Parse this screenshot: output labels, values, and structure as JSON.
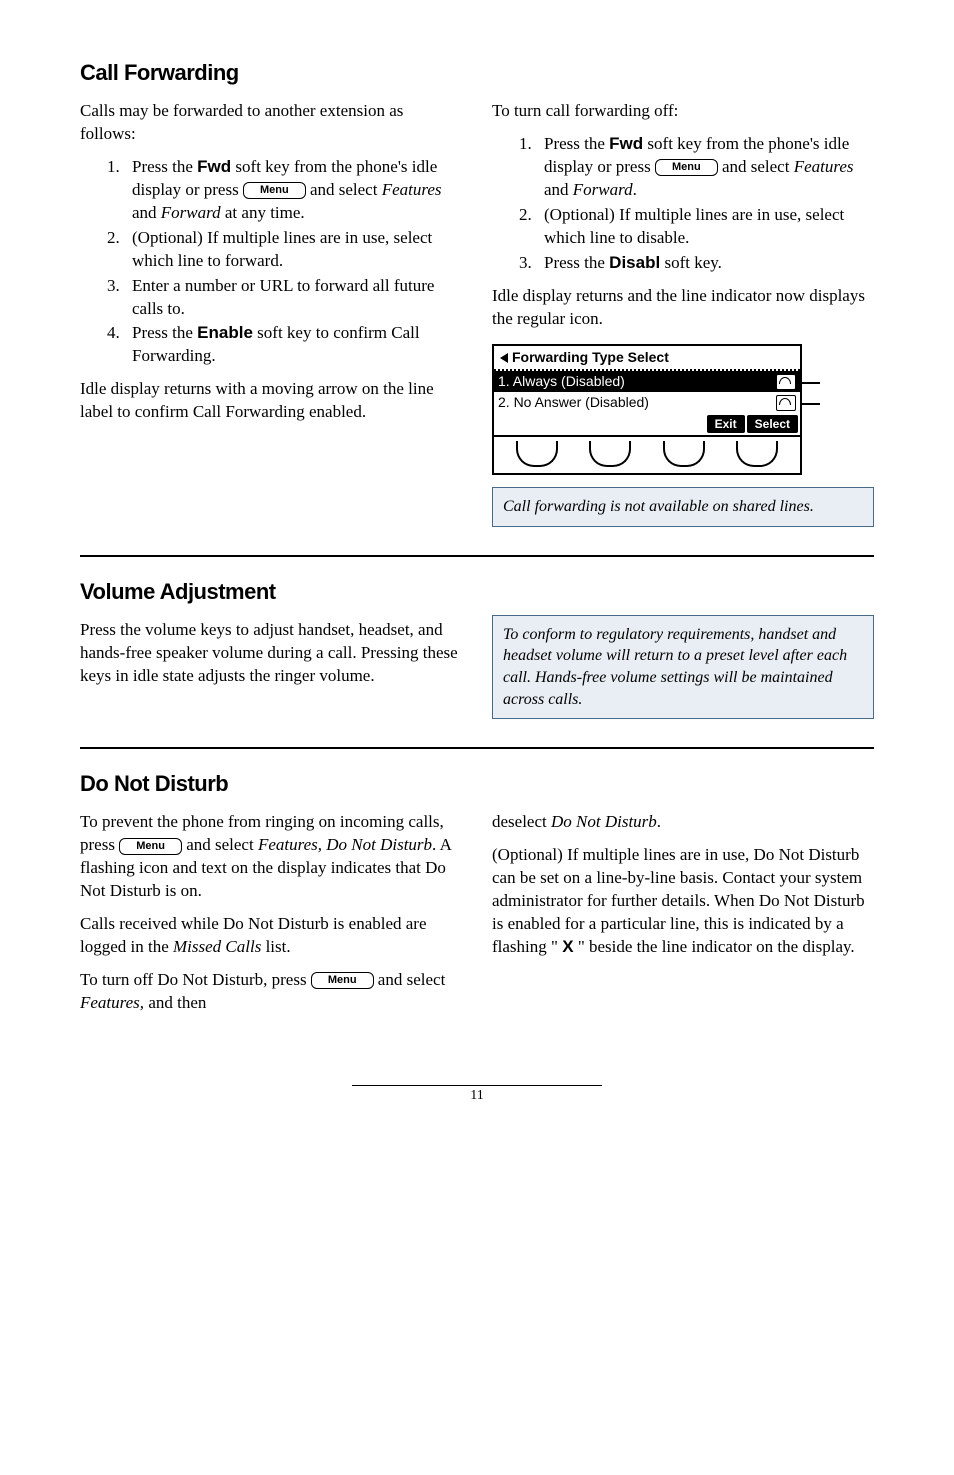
{
  "sections": {
    "call_forwarding": {
      "heading": "Call Forwarding",
      "left": {
        "intro": "Calls may be forwarded to another extension as follows:",
        "steps": {
          "s1_a": "Press the ",
          "s1_key": "Fwd",
          "s1_b": " soft key from the phone's idle display or press ",
          "s1_menu": "Menu",
          "s1_c": " and select ",
          "s1_feat": "Features",
          "s1_d": " and ",
          "s1_fwd": "Forward",
          "s1_e": " at any time.",
          "s2": "(Optional) If multiple lines are in use, select which line to forward.",
          "s3": "Enter a number or URL to forward all future calls to.",
          "s4_a": "Press the ",
          "s4_key": "Enable",
          "s4_b": " soft key to confirm Call Forwarding."
        },
        "outro": "Idle display returns with a moving arrow on the line label to confirm Call Forwarding enabled."
      },
      "right": {
        "intro": "To turn call forwarding off:",
        "steps": {
          "s1_a": "Press the ",
          "s1_key": "Fwd",
          "s1_b": " soft key from the phone's idle display or press ",
          "s1_menu": "Menu",
          "s1_c": " and select ",
          "s1_feat": "Features",
          "s1_d": " and ",
          "s1_fwd": "Forward",
          "s1_e": ".",
          "s2": "(Optional) If multiple lines are in use, select which line to disable.",
          "s3_a": "Press the ",
          "s3_key": "Disabl",
          "s3_b": " soft key."
        },
        "outro": "Idle display returns and the line indicator now displays the regular icon.",
        "screen": {
          "title": "Forwarding Type Select",
          "row1": "1. Always (Disabled)",
          "row2": "2. No Answer (Disabled)",
          "sk1": "Exit",
          "sk2": "Select"
        },
        "note": "Call forwarding is not available on shared lines."
      }
    },
    "volume": {
      "heading": "Volume Adjustment",
      "body": "Press the volume keys to adjust handset, headset, and hands-free speaker volume during a call.  Pressing these keys in idle state adjusts the ringer volume.",
      "note": "To conform to regulatory requirements, handset and headset volume will return to a preset level after each call.  Hands-free volume settings will be maintained across calls."
    },
    "dnd": {
      "heading": "Do Not Disturb",
      "left": {
        "p1_a": "To prevent the phone from ringing on incoming calls, press ",
        "p1_menu": "Menu",
        "p1_b": " and select ",
        "p1_feat": "Features, Do Not Disturb",
        "p1_c": ".  A flashing icon and text on the display indicates that Do Not Disturb is on.",
        "p2_a": "Calls received while Do Not Disturb is enabled are logged in the ",
        "p2_i": "Missed Calls",
        "p2_b": " list.",
        "p3_a": "To turn off Do Not Disturb, press ",
        "p3_menu": "Menu",
        "p3_b": " and select ",
        "p3_feat": "Features,",
        "p3_c": " and then"
      },
      "right": {
        "p1_a": "deselect ",
        "p1_i": "Do Not Disturb",
        "p1_b": ".",
        "p2_a": "(Optional) If multiple lines are in use, Do Not Disturb can be set on a line-by-line basis.  Contact your system administrator for further details.  When Do Not Disturb is enabled for a particular line, this is indicated by a flashing \" ",
        "p2_x": "X",
        "p2_b": " \" beside the line indicator on the display."
      }
    }
  },
  "footer": {
    "page": "11"
  }
}
